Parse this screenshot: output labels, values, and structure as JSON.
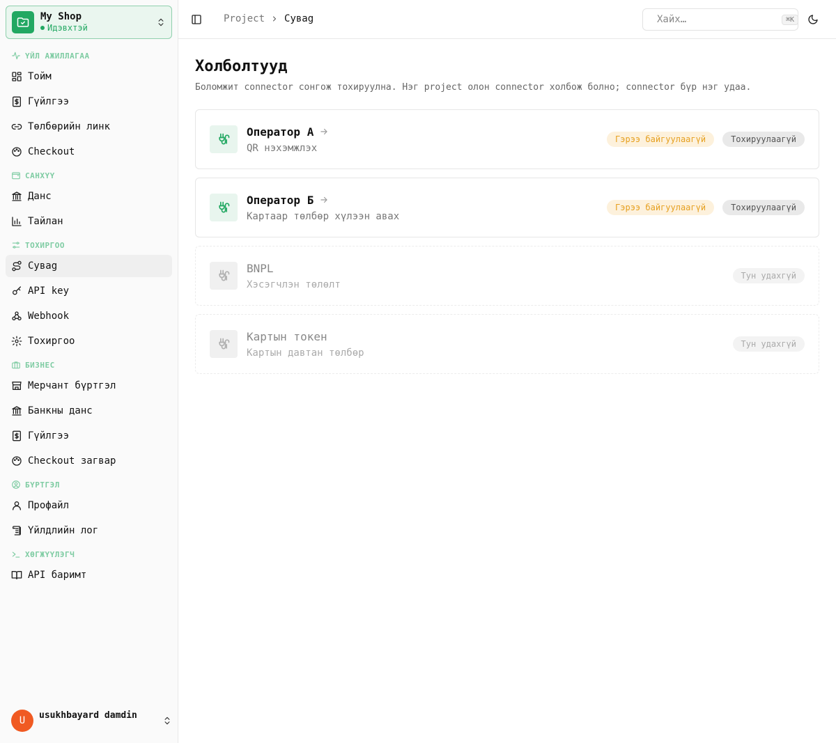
{
  "colors": {
    "accent": "#22a862",
    "warning": "#e6a020",
    "avatar": "#f05a22"
  },
  "shop": {
    "name": "My Shop",
    "status": "Идэвхтэй"
  },
  "sidebar": {
    "sections": [
      {
        "label": "ҮЙЛ АЖИЛЛАГАА",
        "icon": "activity-icon",
        "items": [
          {
            "label": "Тойм",
            "icon": "dashboard-icon"
          },
          {
            "label": "Гүйлгээ",
            "icon": "dollar-receipt-icon"
          },
          {
            "label": "Төлбөрийн линк",
            "icon": "link-icon"
          },
          {
            "label": "Checkout",
            "icon": "palette-icon"
          }
        ]
      },
      {
        "label": "САНХҮҮ",
        "icon": "wallet-icon",
        "items": [
          {
            "label": "Данс",
            "icon": "bank-icon"
          },
          {
            "label": "Тайлан",
            "icon": "chart-icon"
          }
        ]
      },
      {
        "label": "ТОХИРГОО",
        "icon": "sliders-icon",
        "items": [
          {
            "label": "Сувag",
            "icon": "route-icon",
            "active": true
          },
          {
            "label": "API key",
            "icon": "key-icon"
          },
          {
            "label": "Webhook",
            "icon": "webhook-icon"
          },
          {
            "label": "Тохиргоо",
            "icon": "gear-icon"
          }
        ]
      },
      {
        "label": "БИЗНЕС",
        "icon": "briefcase-icon",
        "items": [
          {
            "label": "Мерчант бүртгэл",
            "icon": "store-icon"
          },
          {
            "label": "Банкны данс",
            "icon": "bank-icon"
          },
          {
            "label": "Гүйлгээ",
            "icon": "dollar-receipt-icon"
          },
          {
            "label": "Checkout загвар",
            "icon": "palette-icon"
          }
        ]
      },
      {
        "label": "БҮРТГЭЛ",
        "icon": "user-circle-icon",
        "items": [
          {
            "label": "Профайл",
            "icon": "user-icon"
          },
          {
            "label": "Үйлдлийн лог",
            "icon": "scroll-icon"
          }
        ]
      },
      {
        "label": "ХӨГЖҮҮЛЭГЧ",
        "icon": "terminal-icon",
        "items": [
          {
            "label": "API баримт",
            "icon": "book-icon"
          }
        ]
      }
    ]
  },
  "user": {
    "initial": "U",
    "name": "usukhbayard damdin"
  },
  "header": {
    "breadcrumb": [
      "Project",
      "Сувag"
    ],
    "search_placeholder": "Хайх…",
    "search_shortcut": "⌘K"
  },
  "main": {
    "title": "Холболтууд",
    "description": "Боломжит connector сонгож тохируулна. Нэг project олон connector холбож болно; connector бүр нэг удаа.",
    "connectors": [
      {
        "title": "Оператор A",
        "subtitle": "QR нэхэмжлэх",
        "enabled": true,
        "badges": [
          "Гэрээ байгуулаагүй",
          "Тохируулаагүй"
        ]
      },
      {
        "title": "Оператор Б",
        "subtitle": "Картаар төлбөр хүлээн авах",
        "enabled": true,
        "badges": [
          "Гэрээ байгуулаагүй",
          "Тохируулаагүй"
        ]
      },
      {
        "title": "BNPL",
        "subtitle": "Хэсэгчлэн төлөлт",
        "enabled": false,
        "badges": [
          "Тун удахгүй"
        ]
      },
      {
        "title": "Картын токен",
        "subtitle": "Картын давтан төлбөр",
        "enabled": false,
        "badges": [
          "Тун удахгүй"
        ]
      }
    ]
  }
}
